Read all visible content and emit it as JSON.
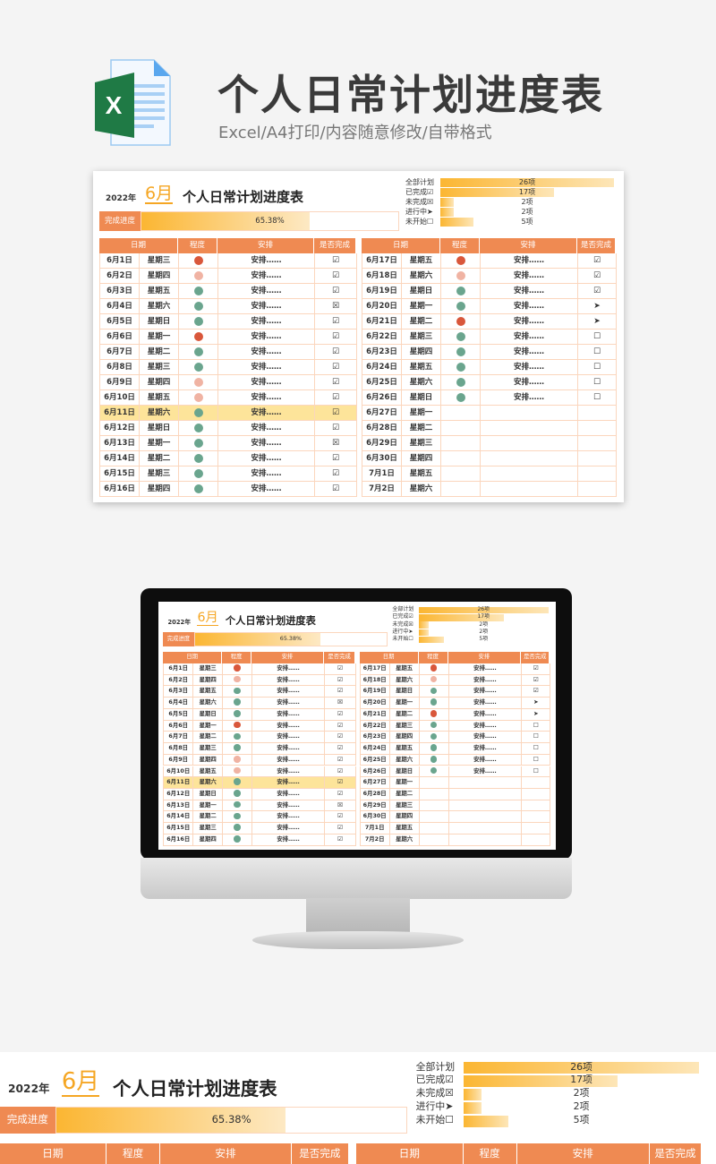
{
  "header": {
    "title": "个人日常计划进度表",
    "subtitle": "Excel/A4打印/内容随意修改/自带格式",
    "logo_letter": "X"
  },
  "sheet": {
    "year": "2022年",
    "month": "6月",
    "title": "个人日常计划进度表",
    "progress_label": "完成进度",
    "progress_value": "65.38%",
    "progress_fraction": 0.6538,
    "stats": [
      {
        "label": "全部计划",
        "value": "26项",
        "count": 26
      },
      {
        "label": "已完成☑",
        "value": "17项",
        "count": 17
      },
      {
        "label": "未完成☒",
        "value": "2项",
        "count": 2
      },
      {
        "label": "进行中➤",
        "value": "2项",
        "count": 2
      },
      {
        "label": "未开始☐",
        "value": "5项",
        "count": 5
      }
    ],
    "columns": [
      "日期",
      "程度",
      "安排",
      "是否完成"
    ],
    "level_colors": {
      "high": "#d9573b",
      "medium": "#f0b3a3",
      "low": "#6aa58e"
    },
    "accent": "#ef8a52",
    "highlight_row": "6月11日",
    "left_rows": [
      {
        "date": "6月1日",
        "weekday": "星期三",
        "level": "high",
        "plan": "安排……",
        "status": "☑"
      },
      {
        "date": "6月2日",
        "weekday": "星期四",
        "level": "medium",
        "plan": "安排……",
        "status": "☑"
      },
      {
        "date": "6月3日",
        "weekday": "星期五",
        "level": "low",
        "plan": "安排……",
        "status": "☑"
      },
      {
        "date": "6月4日",
        "weekday": "星期六",
        "level": "low",
        "plan": "安排……",
        "status": "☒"
      },
      {
        "date": "6月5日",
        "weekday": "星期日",
        "level": "low",
        "plan": "安排……",
        "status": "☑"
      },
      {
        "date": "6月6日",
        "weekday": "星期一",
        "level": "high",
        "plan": "安排……",
        "status": "☑"
      },
      {
        "date": "6月7日",
        "weekday": "星期二",
        "level": "low",
        "plan": "安排……",
        "status": "☑"
      },
      {
        "date": "6月8日",
        "weekday": "星期三",
        "level": "low",
        "plan": "安排……",
        "status": "☑"
      },
      {
        "date": "6月9日",
        "weekday": "星期四",
        "level": "medium",
        "plan": "安排……",
        "status": "☑"
      },
      {
        "date": "6月10日",
        "weekday": "星期五",
        "level": "medium",
        "plan": "安排……",
        "status": "☑"
      },
      {
        "date": "6月11日",
        "weekday": "星期六",
        "level": "low",
        "plan": "安排……",
        "status": "☑"
      },
      {
        "date": "6月12日",
        "weekday": "星期日",
        "level": "low",
        "plan": "安排……",
        "status": "☑"
      },
      {
        "date": "6月13日",
        "weekday": "星期一",
        "level": "low",
        "plan": "安排……",
        "status": "☒"
      },
      {
        "date": "6月14日",
        "weekday": "星期二",
        "level": "low",
        "plan": "安排……",
        "status": "☑"
      },
      {
        "date": "6月15日",
        "weekday": "星期三",
        "level": "low",
        "plan": "安排……",
        "status": "☑"
      },
      {
        "date": "6月16日",
        "weekday": "星期四",
        "level": "low",
        "plan": "安排……",
        "status": "☑"
      }
    ],
    "right_rows": [
      {
        "date": "6月17日",
        "weekday": "星期五",
        "level": "high",
        "plan": "安排……",
        "status": "☑"
      },
      {
        "date": "6月18日",
        "weekday": "星期六",
        "level": "medium",
        "plan": "安排……",
        "status": "☑"
      },
      {
        "date": "6月19日",
        "weekday": "星期日",
        "level": "low",
        "plan": "安排……",
        "status": "☑"
      },
      {
        "date": "6月20日",
        "weekday": "星期一",
        "level": "low",
        "plan": "安排……",
        "status": "➤"
      },
      {
        "date": "6月21日",
        "weekday": "星期二",
        "level": "high",
        "plan": "安排……",
        "status": "➤"
      },
      {
        "date": "6月22日",
        "weekday": "星期三",
        "level": "low",
        "plan": "安排……",
        "status": "☐"
      },
      {
        "date": "6月23日",
        "weekday": "星期四",
        "level": "low",
        "plan": "安排……",
        "status": "☐"
      },
      {
        "date": "6月24日",
        "weekday": "星期五",
        "level": "low",
        "plan": "安排……",
        "status": "☐"
      },
      {
        "date": "6月25日",
        "weekday": "星期六",
        "level": "low",
        "plan": "安排……",
        "status": "☐"
      },
      {
        "date": "6月26日",
        "weekday": "星期日",
        "level": "low",
        "plan": "安排……",
        "status": "☐"
      },
      {
        "date": "6月27日",
        "weekday": "星期一",
        "level": "",
        "plan": "",
        "status": ""
      },
      {
        "date": "6月28日",
        "weekday": "星期二",
        "level": "",
        "plan": "",
        "status": ""
      },
      {
        "date": "6月29日",
        "weekday": "星期三",
        "level": "",
        "plan": "",
        "status": ""
      },
      {
        "date": "6月30日",
        "weekday": "星期四",
        "level": "",
        "plan": "",
        "status": ""
      },
      {
        "date": "7月1日",
        "weekday": "星期五",
        "level": "",
        "plan": "",
        "status": ""
      },
      {
        "date": "7月2日",
        "weekday": "星期六",
        "level": "",
        "plan": "",
        "status": ""
      }
    ]
  }
}
